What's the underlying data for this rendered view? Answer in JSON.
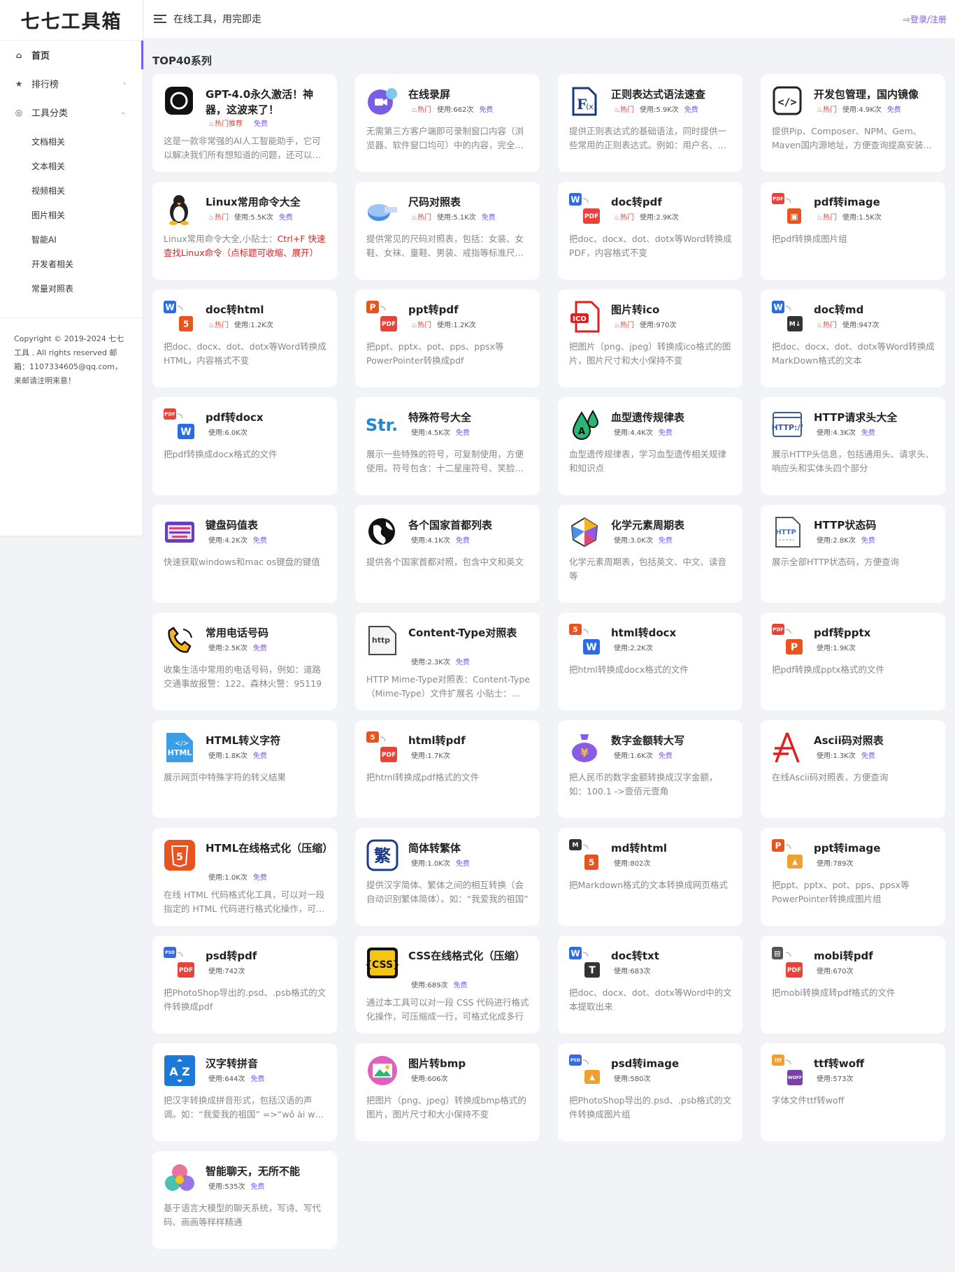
{
  "sidebar": {
    "logo": "七七工具箱",
    "home": "首页",
    "ranking": "排行榜",
    "categories": "工具分类",
    "sub_items": [
      "文档相关",
      "文本相关",
      "视频相关",
      "图片相关",
      "智能AI",
      "开发者相关",
      "常量对照表"
    ],
    "copyright": "Copyright © 2019-2024 七七工具 . All rights reserved 邮箱：1107334605@qq.com，来邮请注明来意！"
  },
  "header": {
    "slogan": "在线工具，用完即走",
    "login": "登录/注册"
  },
  "section": {
    "title": "TOP40系列"
  },
  "tools": [
    {
      "title": "GPT-4.0永久激活！神器，这波来了！",
      "hot": "热门推荐",
      "usage": "",
      "free": "免费",
      "desc": "这是一款非常强的AI人工智能助手，它可以解决我们所有想知道的问题，还可以写代码、写文章",
      "icon": "openai-icon",
      "icon_color": "#111111"
    },
    {
      "title": "在线录屏",
      "hot": "热门",
      "usage": "使用:662次",
      "free": "免费",
      "desc": "无需第三方客户端即可录制窗口内容（浏览器、软件窗口均可）中的内容，完全免费",
      "icon": "screen-record-icon",
      "icon_color": "#7b5ce6"
    },
    {
      "title": "正则表达式语法速查",
      "hot": "热门",
      "usage": "使用:5.9K次",
      "free": "免费",
      "desc": "提供正则表达式的基础语法，同时提供一些常用的正则表达式。例如：用户名、密码",
      "icon": "regex-icon",
      "icon_color": "#1a3a7a"
    },
    {
      "title": "开发包管理，国内镜像",
      "hot": "热门",
      "usage": "使用:4.9K次",
      "free": "免费",
      "desc": "提供Pip、Composer、NPM、Gem、Maven国内源地址，方便查询提高安装速度",
      "icon": "code-icon",
      "icon_color": "#222222"
    },
    {
      "title": "Linux常用命令大全",
      "hot": "热门",
      "usage": "使用:5.5K次",
      "free": "免费",
      "desc_prefix": "Linux常用命令大全,小贴士：",
      "desc_red": "Ctrl+F 快速查找Linux命令（点标题可收缩、展开）",
      "desc": "",
      "icon": "penguin-icon",
      "icon_color": "#222222"
    },
    {
      "title": "尺码对照表",
      "hot": "热门",
      "usage": "使用:5.1K次",
      "free": "免费",
      "desc": "提供常见的尺码对照表，包括：女装、女鞋、女袜、童鞋、男装、戒指等标准尺码对照",
      "icon": "tape-measure-icon",
      "icon_color": "#4a8fe7"
    },
    {
      "title": "doc转pdf",
      "hot": "热门",
      "usage": "使用:2.9K次",
      "free": "",
      "desc": "把doc、docx、dot、dotx等Word转换成PDF，内容格式不变",
      "icon": "word-to-pdf-icon",
      "icon_color": "#2b6de0"
    },
    {
      "title": "pdf转image",
      "hot": "热门",
      "usage": "使用:1.5K次",
      "free": "",
      "desc": "把pdf转换成图片组",
      "icon": "pdf-to-image-icon",
      "icon_color": "#e8433a"
    },
    {
      "title": "doc转html",
      "hot": "热门",
      "usage": "使用:1.2K次",
      "free": "",
      "desc": "把doc、docx、dot、dotx等Word转换成HTML，内容格式不变",
      "icon": "word-to-html-icon",
      "icon_color": "#2b6de0"
    },
    {
      "title": "ppt转pdf",
      "hot": "热门",
      "usage": "使用:1.2K次",
      "free": "",
      "desc": "把ppt、pptx、pot、pps、ppsx等PowerPointer转换成pdf",
      "icon": "ppt-to-pdf-icon",
      "icon_color": "#e8531e"
    },
    {
      "title": "图片转ico",
      "hot": "热门",
      "usage": "使用:970次",
      "free": "",
      "desc": "把图片（png、jpeg）转换成ico格式的图片，图片尺寸和大小保持不变",
      "icon": "ico-file-icon",
      "icon_color": "#e02020"
    },
    {
      "title": "doc转md",
      "hot": "热门",
      "usage": "使用:947次",
      "free": "",
      "desc": "把doc、docx、dot、dotx等Word转换成MarkDown格式的文本",
      "icon": "word-to-md-icon",
      "icon_color": "#2b6de0"
    },
    {
      "title": "pdf转docx",
      "hot": "",
      "usage": "使用:6.0K次",
      "free": "",
      "desc": "把pdf转换成docx格式的文件",
      "icon": "pdf-to-word-icon",
      "icon_color": "#e8433a"
    },
    {
      "title": "特殊符号大全",
      "hot": "",
      "usage": "使用:4.5K次",
      "free": "免费",
      "desc": "展示一些特殊的符号，可复制使用，方便使用。符号包含：十二星座符号、笑脸符号等",
      "icon": "str-symbol-icon",
      "icon_color": "#1e88d8"
    },
    {
      "title": "血型遗传规律表",
      "hot": "",
      "usage": "使用:4.4K次",
      "free": "免费",
      "desc": "血型遗传规律表，学习血型遗传相关规律和知识点",
      "icon": "blood-drop-icon",
      "icon_color": "#2bb673"
    },
    {
      "title": "HTTP请求头大全",
      "hot": "",
      "usage": "使用:4.3K次",
      "free": "免费",
      "desc": "展示HTTP头信息，包括通用头、请求头、响应头和实体头四个部分",
      "icon": "http-window-icon",
      "icon_color": "#3a5aa8"
    },
    {
      "title": "键盘码值表",
      "hot": "",
      "usage": "使用:4.2K次",
      "free": "免费",
      "desc": "快速获取windows和mac os键盘的键值",
      "icon": "keyboard-icon",
      "icon_color": "#6a3fb8"
    },
    {
      "title": "各个国家首都列表",
      "hot": "",
      "usage": "使用:4.1K次",
      "free": "免费",
      "desc": "提供各个国家首都对照，包含中文和英文",
      "icon": "globe-icon",
      "icon_color": "#111111"
    },
    {
      "title": "化学元素周期表",
      "hot": "",
      "usage": "使用:3.0K次",
      "free": "免费",
      "desc": "化学元素周期表，包括英文、中文、读音等",
      "icon": "crystal-icon",
      "icon_color": "#d94a7a"
    },
    {
      "title": "HTTP状态码",
      "hot": "",
      "usage": "使用:2.8K次",
      "free": "免费",
      "desc": "展示全部HTTP状态码，方便查询",
      "icon": "http-doc-icon",
      "icon_color": "#3a7ac8"
    },
    {
      "title": "常用电话号码",
      "hot": "",
      "usage": "使用:2.5K次",
      "free": "免费",
      "desc": "收集生活中常用的电话号码，例如：道路交通事故报警：122、森林火警：95119",
      "icon": "phone-icon",
      "icon_color": "#f6b51e"
    },
    {
      "title": "Content-Type对照表",
      "hot": "",
      "usage": "使用:2.3K次",
      "free": "免费",
      "desc": "HTTP Mime-Type对照表：Content-Type（Mime-Type）文件扩展名 小贴士：Ctrl+F",
      "icon": "http-file-icon",
      "icon_color": "#444444"
    },
    {
      "title": "html转docx",
      "hot": "",
      "usage": "使用:2.2K次",
      "free": "",
      "desc": "把html转换成docx格式的文件",
      "icon": "html-to-word-icon",
      "icon_color": "#e8531e"
    },
    {
      "title": "pdf转pptx",
      "hot": "",
      "usage": "使用:1.9K次",
      "free": "",
      "desc": "把pdf转换成pptx格式的文件",
      "icon": "pdf-to-ppt-icon",
      "icon_color": "#e8433a"
    },
    {
      "title": "HTML转义字符",
      "hot": "",
      "usage": "使用:1.8K次",
      "free": "免费",
      "desc": "展示网页中特殊字符的转义结果",
      "icon": "html-file-icon",
      "icon_color": "#3a9ee8"
    },
    {
      "title": "html转pdf",
      "hot": "",
      "usage": "使用:1.7K次",
      "free": "",
      "desc": "把html转换成pdf格式的文件",
      "icon": "html-to-pdf-icon",
      "icon_color": "#e8531e"
    },
    {
      "title": "数字金额转大写",
      "hot": "",
      "usage": "使用:1.6K次",
      "free": "免费",
      "desc": "把人民币的数字金额转换成汉字金额，如：100.1 ->壹佰元壹角",
      "icon": "money-bag-icon",
      "icon_color": "#8a5ce6"
    },
    {
      "title": "Ascii码对照表",
      "hot": "",
      "usage": "使用:1.3K次",
      "free": "免费",
      "desc": "在线Ascii码对照表，方便查询",
      "icon": "ascii-icon",
      "icon_color": "#e02020"
    },
    {
      "title": "HTML在线格式化（压缩）",
      "hot": "",
      "usage": "使用:1.0K次",
      "free": "免费",
      "desc": "在线 HTML 代码格式化工具，可以对一段指定的 HTML 代码进行格式化操作，可压缩",
      "icon": "html5-icon",
      "icon_color": "#e8531e"
    },
    {
      "title": "简体转繁体",
      "hot": "",
      "usage": "使用:1.0K次",
      "free": "免费",
      "desc": "提供汉字简体、繁体之间的相互转换（会自动识别繁体简体）。如：“我爱我的祖国”",
      "icon": "traditional-char-icon",
      "icon_color": "#1a3a8a"
    },
    {
      "title": "md转html",
      "hot": "",
      "usage": "使用:802次",
      "free": "",
      "desc": "把Markdown格式的文本转换成网页格式",
      "icon": "md-to-html-icon",
      "icon_color": "#333333"
    },
    {
      "title": "ppt转image",
      "hot": "",
      "usage": "使用:789次",
      "free": "",
      "desc": "把ppt、pptx、pot、pps、ppsx等PowerPointer转换成图片组",
      "icon": "ppt-to-image-icon",
      "icon_color": "#e8531e"
    },
    {
      "title": "psd转pdf",
      "hot": "",
      "usage": "使用:742次",
      "free": "",
      "desc": "把PhotoShop导出的.psd、.psb格式的文件转换成pdf",
      "icon": "psd-to-pdf-icon",
      "icon_color": "#3a6ad8"
    },
    {
      "title": "CSS在线格式化（压缩）",
      "hot": "",
      "usage": "使用:689次",
      "free": "免费",
      "desc": "通过本工具可以对一段 CSS 代码进行格式化操作，可压缩成一行，可格式化成多行",
      "icon": "css-icon",
      "icon_color": "#f6c514"
    },
    {
      "title": "doc转txt",
      "hot": "",
      "usage": "使用:683次",
      "free": "",
      "desc": "把doc、docx、dot、dotx等Word中的文本提取出来",
      "icon": "word-to-txt-icon",
      "icon_color": "#2b6de0"
    },
    {
      "title": "mobi转pdf",
      "hot": "",
      "usage": "使用:670次",
      "free": "",
      "desc": "把mobi转换成转pdf格式的文件",
      "icon": "mobi-to-pdf-icon",
      "icon_color": "#555555"
    },
    {
      "title": "汉字转拼音",
      "hot": "",
      "usage": "使用:644次",
      "free": "免费",
      "desc": "把汉字转换成拼音形式，包括汉语的声调。如：“我爱我的祖国” =>“wǒ ài wǒ de zǔ guó”",
      "icon": "az-sort-icon",
      "icon_color": "#1e78d8"
    },
    {
      "title": "图片转bmp",
      "hot": "",
      "usage": "使用:606次",
      "free": "",
      "desc": "把图片（png、jpeg）转换成bmp格式的图片，图片尺寸和大小保持不变",
      "icon": "image-circle-icon",
      "icon_color": "#c84ad8"
    },
    {
      "title": "psd转image",
      "hot": "",
      "usage": "使用:580次",
      "free": "",
      "desc": "把PhotoShop导出的.psd、.psb格式的文件转换成图片组",
      "icon": "psd-to-image-icon",
      "icon_color": "#3a6ad8"
    },
    {
      "title": "ttf转woff",
      "hot": "",
      "usage": "使用:573次",
      "free": "",
      "desc": "字体文件ttf转woff",
      "icon": "ttf-to-woff-icon",
      "icon_color": "#f0a030"
    },
    {
      "title": "智能聊天，无所不能",
      "hot": "",
      "usage": "使用:535次",
      "free": "免费",
      "desc": "基于语言大模型的聊天系统，写诗、写代码、画画等样样精通",
      "icon": "chat-circles-icon",
      "icon_color": "#e85a8a"
    }
  ]
}
